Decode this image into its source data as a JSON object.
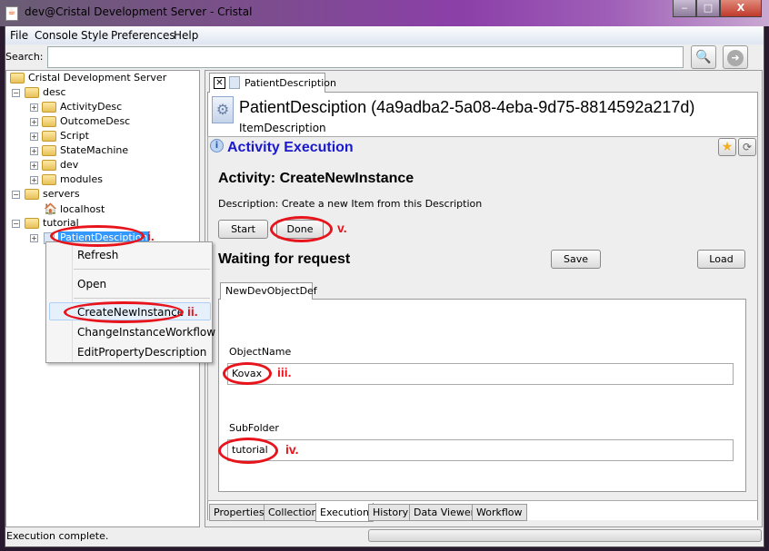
{
  "window": {
    "title": "dev@Cristal Development Server - Cristal",
    "min": "‒",
    "max": "□",
    "close": "X"
  },
  "menu": [
    "File",
    "Console",
    "Style",
    "Preferences",
    "Help"
  ],
  "search": {
    "label": "Search:",
    "value": ""
  },
  "tree": {
    "root": "Cristal Development Server",
    "nodes": [
      "desc",
      "ActivityDesc",
      "OutcomeDesc",
      "Script",
      "StateMachine",
      "dev",
      "modules",
      "servers",
      "localhost",
      "tutorial",
      "PatientDesciption"
    ]
  },
  "context_menu": [
    "Refresh",
    "Open",
    "CreateNewInstance",
    "ChangeInstanceWorkflow",
    "EditPropertyDescription"
  ],
  "doc_tab": "PatientDescription",
  "item": {
    "title": "PatientDesciption (4a9adba2-5a08-4eba-9d75-8814592a217d)",
    "type": "ItemDescription"
  },
  "execution": {
    "heading": "Activity Execution",
    "activity": "Activity: CreateNewInstance",
    "description": "Description: Create a new Item from this Description",
    "start": "Start",
    "done": "Done",
    "status": "Waiting for request",
    "save": "Save",
    "load": "Load",
    "form_tab": "NewDevObjectDef",
    "fields": [
      {
        "label": "ObjectName",
        "value": "Kovax"
      },
      {
        "label": "SubFolder",
        "value": "tutorial"
      }
    ]
  },
  "bottom_tabs": [
    "Properties",
    "Collection",
    "Execution",
    "History",
    "Data Viewer",
    "Workflow"
  ],
  "active_tab": "Execution",
  "status_bar": "Execution complete.",
  "annotations": [
    "i.",
    "ii.",
    "iii.",
    "iv.",
    "v."
  ],
  "colors": {
    "annotation": "#e8141c",
    "heading": "#1a1acc",
    "selection": "#3399ff"
  }
}
